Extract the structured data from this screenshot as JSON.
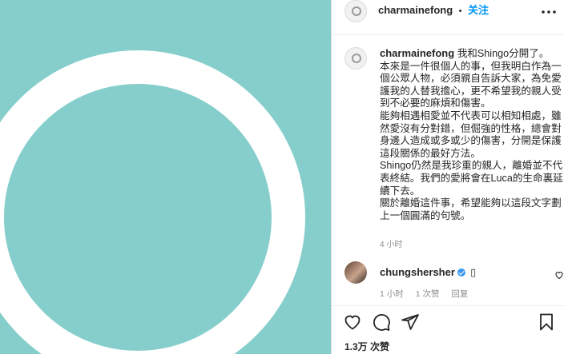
{
  "post": {
    "username": "charmainefong",
    "separator": "•",
    "follow_label": "关注",
    "more_icon": "more-options-icon",
    "caption": {
      "username": "charmainefong",
      "lines": [
        "我和Shingo分開了。",
        "本來是一件很個人的事，但我明白作為一個公眾人物，必須親自告訴大家，為免愛護我的人替我擔心，更不希望我的親人受到不必要的麻煩和傷害。",
        "能夠相遇相愛並不代表可以相知相處，雖然愛沒有分對錯，但倔強的性格，總會對身邊人造成或多或少的傷害，分開是保護這段關係的最好方法。",
        "Shingo仍然是我珍重的親人，離婚並不代表終結。我們的愛將會在Luca的生命裏延續下去。",
        "關於離婚這件事，希望能夠以這段文字劃上一個圓滿的句號。"
      ],
      "time": "4 小时"
    },
    "comment": {
      "username": "chungshersher",
      "text": "▯",
      "time": "1 小时",
      "likes": "1 次赞",
      "reply": "回复"
    },
    "likes_count": "1.3万 次赞"
  },
  "colors": {
    "media_bg": "#86cecb",
    "ring": "#ffffff",
    "link": "#0095f6",
    "verified": "#3897f0"
  }
}
